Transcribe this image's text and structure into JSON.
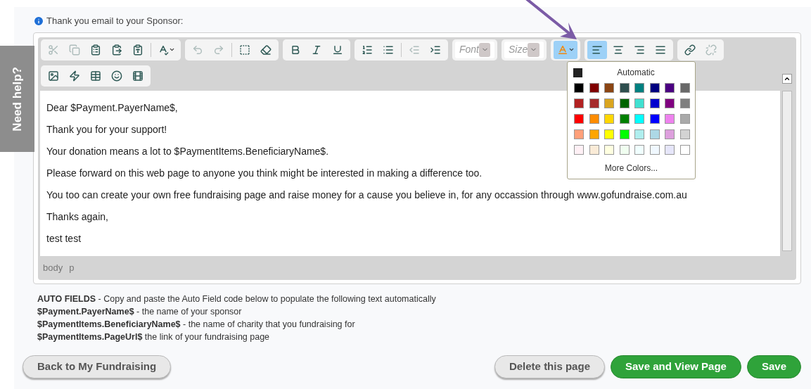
{
  "help_tab": {
    "label": "Need help?"
  },
  "field_label": "Thank you email to your Sponsor:",
  "toolbar_rows": [
    [
      [
        {
          "kind": "button",
          "disabled": true,
          "selected": false
        },
        {
          "kind": "button",
          "disabled": true,
          "selected": false
        },
        {
          "kind": "button",
          "disabled": false,
          "selected": false
        },
        {
          "kind": "button",
          "disabled": false,
          "selected": false
        },
        {
          "kind": "button",
          "disabled": false,
          "selected": false
        },
        {
          "kind": "separator"
        },
        {
          "kind": "menu",
          "disabled": false,
          "selected": false
        }
      ],
      [
        {
          "kind": "button",
          "disabled": true,
          "selected": false
        },
        {
          "kind": "button",
          "disabled": true,
          "selected": false
        },
        {
          "kind": "separator"
        },
        {
          "kind": "button",
          "disabled": false,
          "selected": false
        },
        {
          "kind": "button",
          "disabled": false,
          "selected": false
        }
      ],
      [
        {
          "kind": "button",
          "disabled": false,
          "selected": false
        },
        {
          "kind": "button",
          "disabled": false,
          "selected": false
        },
        {
          "kind": "button",
          "disabled": false,
          "selected": false
        }
      ],
      [
        {
          "kind": "button",
          "disabled": false,
          "selected": false
        },
        {
          "kind": "button",
          "disabled": false,
          "selected": false
        },
        {
          "kind": "separator"
        },
        {
          "kind": "button",
          "disabled": true,
          "selected": false
        },
        {
          "kind": "button",
          "disabled": false,
          "selected": false
        }
      ],
      [
        {
          "kind": "select",
          "placeholder": "Font"
        }
      ],
      [
        {
          "kind": "select",
          "placeholder": "Size"
        }
      ],
      [
        {
          "kind": "menu",
          "disabled": false,
          "selected": true
        }
      ],
      [
        {
          "kind": "button",
          "disabled": false,
          "selected": true
        },
        {
          "kind": "button",
          "disabled": false,
          "selected": false
        },
        {
          "kind": "button",
          "disabled": false,
          "selected": false
        },
        {
          "kind": "button",
          "disabled": false,
          "selected": false
        }
      ],
      [
        {
          "kind": "button",
          "disabled": false,
          "selected": false
        },
        {
          "kind": "button",
          "disabled": true,
          "selected": false
        }
      ]
    ],
    [
      [
        {
          "kind": "button",
          "disabled": false,
          "selected": false
        },
        {
          "kind": "button",
          "disabled": false,
          "selected": false
        },
        {
          "kind": "button",
          "disabled": false,
          "selected": false
        },
        {
          "kind": "button",
          "disabled": false,
          "selected": false
        },
        {
          "kind": "button",
          "disabled": false,
          "selected": false
        }
      ]
    ]
  ],
  "editor_paragraphs": [
    "Dear $Payment.PayerName$,",
    "Thank you for your support!",
    "Your donation means a lot to $PaymentItems.BeneficiaryName$.",
    "Please forward on this web page to anyone you think might be interested in making a difference too.",
    "You too can create your own free fundraising page and raise money for a cause you believe in, for any occassion through www.gofundraise.com.au",
    "Thanks again,",
    "test test"
  ],
  "element_path": [
    "body",
    "p"
  ],
  "color_menu": {
    "automatic": {
      "label": "Automatic",
      "color": "#222222"
    },
    "swatches": [
      {
        "color": "#000000"
      },
      {
        "color": "#800000"
      },
      {
        "color": "#8b4513"
      },
      {
        "color": "#2f4f4f"
      },
      {
        "color": "#008080"
      },
      {
        "color": "#000080"
      },
      {
        "color": "#4b0082"
      },
      {
        "color": "#696969"
      },
      {
        "color": "#b22222"
      },
      {
        "color": "#a52a2a"
      },
      {
        "color": "#daa520"
      },
      {
        "color": "#006400"
      },
      {
        "color": "#40e0d0"
      },
      {
        "color": "#0000cd"
      },
      {
        "color": "#800080"
      },
      {
        "color": "#808080"
      },
      {
        "color": "#ff0000"
      },
      {
        "color": "#ff8c00"
      },
      {
        "color": "#ffd700"
      },
      {
        "color": "#008000"
      },
      {
        "color": "#00ffff"
      },
      {
        "color": "#0000ff"
      },
      {
        "color": "#ee82ee"
      },
      {
        "color": "#a9a9a9"
      },
      {
        "color": "#ffa07a"
      },
      {
        "color": "#ffa500"
      },
      {
        "color": "#ffff00"
      },
      {
        "color": "#00ff00"
      },
      {
        "color": "#afeeee"
      },
      {
        "color": "#add8e6"
      },
      {
        "color": "#dda0dd"
      },
      {
        "color": "#d3d3d3"
      },
      {
        "color": "#fff0f5"
      },
      {
        "color": "#faebd7"
      },
      {
        "color": "#ffffe0"
      },
      {
        "color": "#f0fff0"
      },
      {
        "color": "#f0ffff"
      },
      {
        "color": "#f0f8ff"
      },
      {
        "color": "#e6e6fa"
      },
      {
        "color": "#ffffff"
      }
    ],
    "more_label": "More Colors..."
  },
  "auto_fields": [
    "**AUTO FIELDS** - Copy and paste the Auto Field code below to populate the following text automatically",
    "**$Payment.PayerName$** - the name of your sponsor",
    "**$PaymentItems.BeneficiaryName$** - the name of charity that you fundraising for",
    "**$PaymentItems.PageUrl$** the link of your fundraising page"
  ],
  "buttons": [
    {
      "label": "Back to My Fundraising",
      "kind": "secondary"
    },
    {
      "label": "Delete this page",
      "kind": "secondary"
    },
    {
      "label": "Save and View Page",
      "kind": "primary"
    },
    {
      "label": "Save",
      "kind": "primary"
    }
  ]
}
